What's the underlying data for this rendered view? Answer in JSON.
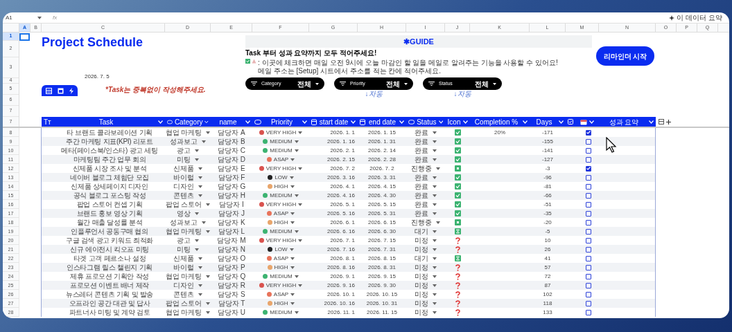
{
  "toolbar": {
    "cell_ref": "A1",
    "fx": "fx",
    "summary_button": "이 데이터 요약"
  },
  "column_letters": [
    {
      "label": "A",
      "selected": true
    },
    {
      "label": "B",
      "selected": false
    },
    {
      "label": "C",
      "selected": false
    },
    {
      "label": "D",
      "selected": false
    },
    {
      "label": "E",
      "selected": false
    },
    {
      "label": "F",
      "selected": false
    },
    {
      "label": "G",
      "selected": false
    },
    {
      "label": "H",
      "selected": false
    },
    {
      "label": "I",
      "selected": false
    },
    {
      "label": "J",
      "selected": false
    },
    {
      "label": "K",
      "selected": false
    },
    {
      "label": "L",
      "selected": false
    },
    {
      "label": "M",
      "selected": false
    },
    {
      "label": "N",
      "selected": false
    },
    {
      "label": "O",
      "selected": false
    },
    {
      "label": "P",
      "selected": false
    },
    {
      "label": "Q",
      "selected": false
    }
  ],
  "upper_rows": [
    {
      "label": "1",
      "selected": true
    },
    {
      "label": "2",
      "selected": false
    },
    {
      "label": "3",
      "selected": false
    },
    {
      "label": "4",
      "selected": false
    },
    {
      "label": "5",
      "selected": false
    },
    {
      "label": "6",
      "selected": false
    },
    {
      "label": "7",
      "selected": false
    }
  ],
  "title": "Project Schedule",
  "date": "2026. 7. 5",
  "note": "*Task는 중복없이 작성해주세요.",
  "guide": {
    "heading": "✱GUIDE",
    "line1": "Task 부터  성과 요약까지 모두 적어주세요!",
    "line2": ": 이곳에 체크하면 매일 오전 9시에 오늘 마감인 할 일을 메일로 알려주는 기능을 사용할 수 있어요!",
    "line3": "메일 주소는 [Setup] 시트에서 주소를 적는 칸에 적어주세요."
  },
  "reminder_button": "리마인더 시작",
  "header_row": "7",
  "filters": [
    {
      "label": "Category",
      "value": "전체"
    },
    {
      "label": "Priority",
      "value": "전체",
      "auto": "↓자동"
    },
    {
      "label": "Status",
      "value": "전체",
      "auto": "↓자동"
    }
  ],
  "columns": [
    {
      "label": "Tт",
      "kind": "type"
    },
    {
      "label": "Task",
      "kind": "text"
    },
    {
      "label": "Category",
      "kind": "chip"
    },
    {
      "label": "name",
      "kind": "text"
    },
    {
      "label": "Priority",
      "kind": "chip"
    },
    {
      "label": "start date",
      "kind": "date"
    },
    {
      "label": "end date",
      "kind": "date"
    },
    {
      "label": "Status",
      "kind": "chip"
    },
    {
      "label": "Icon",
      "kind": "text"
    },
    {
      "label": "Completion %",
      "kind": "text"
    },
    {
      "label": "Days",
      "kind": "text"
    },
    {
      "kind": "checkbox"
    },
    {
      "kind": "calendar"
    },
    {
      "label": "성과 요약",
      "kind": "text"
    }
  ],
  "rows": [
    {
      "num": "8",
      "task": "타 브랜드 콜라보레이션 기획",
      "category": "협업 마케팅",
      "name": "담당자 A",
      "priority": {
        "label": "VERY HIGH",
        "color": "#d9534f"
      },
      "start": "2026. 1. 1",
      "end": "2026. 1. 15",
      "status": "완료",
      "kind": "done",
      "completion": "20%",
      "days": "-171",
      "checked": true
    },
    {
      "num": "9",
      "task": "주간 마케팅 지표(KPI) 리포트",
      "category": "성과보고",
      "name": "담당자 B",
      "priority": {
        "label": "MEDIUM",
        "color": "#3cb371"
      },
      "start": "2026. 1. 16",
      "end": "2026. 1. 31",
      "status": "완료",
      "kind": "done",
      "days": "-155",
      "checked": false
    },
    {
      "num": "10",
      "task": "메타(페이스북/인스타) 광고 세팅",
      "category": "광고",
      "name": "담당자 C",
      "priority": {
        "label": "MEDIUM",
        "color": "#3cb371"
      },
      "start": "2026. 2. 1",
      "end": "2026. 2. 14",
      "status": "완료",
      "kind": "done",
      "days": "-141",
      "checked": false
    },
    {
      "num": "11",
      "task": "마케팅팀 주간 업무 회의",
      "category": "미팅",
      "name": "담당자 D",
      "priority": {
        "label": "ASAP",
        "color": "#e8735a"
      },
      "start": "2026. 2. 15",
      "end": "2026. 2. 28",
      "status": "완료",
      "kind": "done",
      "days": "-127",
      "checked": false
    },
    {
      "num": "12",
      "task": "신제품 시장 조사 및 분석",
      "category": "신제품",
      "name": "담당자 E",
      "priority": {
        "label": "VERY HIGH",
        "color": "#d9534f"
      },
      "start": "2026. 7. 2",
      "end": "2026. 7. 2",
      "status": "진행중",
      "kind": "progress",
      "days": "-3",
      "checked": true
    },
    {
      "num": "13",
      "task": "네이버 블로그 체험단 모집",
      "category": "바이럴",
      "name": "담당자 F",
      "priority": {
        "label": "LOW",
        "color": "#222222"
      },
      "start": "2026. 3. 16",
      "end": "2026. 3. 31",
      "status": "완료",
      "kind": "done",
      "days": "-96",
      "checked": false
    },
    {
      "num": "14",
      "task": "신제품 상세페이지 디자인",
      "category": "디자인",
      "name": "담당자 G",
      "priority": {
        "label": "HIGH",
        "color": "#e8a56b"
      },
      "start": "2026. 4. 1",
      "end": "2026. 4. 15",
      "status": "완료",
      "kind": "done",
      "days": "-81",
      "checked": false
    },
    {
      "num": "15",
      "task": "공식 블로그 포스팅 작성",
      "category": "콘텐츠",
      "name": "담당자 H",
      "priority": {
        "label": "MEDIUM",
        "color": "#3cb371"
      },
      "start": "2026. 4. 16",
      "end": "2026. 4. 30",
      "status": "완료",
      "kind": "done",
      "days": "-66",
      "checked": false
    },
    {
      "num": "16",
      "task": "팝업 스토어 컨셉 기획",
      "category": "팝업 스토어",
      "name": "담당자 I",
      "priority": {
        "label": "VERY HIGH",
        "color": "#d9534f"
      },
      "start": "2026. 5. 1",
      "end": "2026. 5. 15",
      "status": "완료",
      "kind": "done",
      "days": "-51",
      "checked": false
    },
    {
      "num": "17",
      "task": "브랜드 홍보 영상 기획",
      "category": "영상",
      "name": "담당자 J",
      "priority": {
        "label": "ASAP",
        "color": "#e8735a"
      },
      "start": "2026. 5. 16",
      "end": "2026. 5. 31",
      "status": "완료",
      "kind": "done",
      "days": "-35",
      "checked": false
    },
    {
      "num": "18",
      "task": "월간 매출 달성률 분석",
      "category": "성과보고",
      "name": "담당자 K",
      "priority": {
        "label": "HIGH",
        "color": "#e8a56b"
      },
      "start": "2026. 6. 1",
      "end": "2026. 6. 15",
      "status": "진행중",
      "kind": "progress",
      "days": "-20",
      "checked": false
    },
    {
      "num": "19",
      "task": "인플루언서 공동구매 협의",
      "category": "협업 마케팅",
      "name": "담당자 L",
      "priority": {
        "label": "MEDIUM",
        "color": "#3cb371"
      },
      "start": "2026. 6. 16",
      "end": "2026. 6. 30",
      "status": "대기",
      "kind": "waiting",
      "days": "-5",
      "checked": false
    },
    {
      "num": "20",
      "task": "구글 검색 광고 키워드 최적화",
      "category": "광고",
      "name": "담당자 M",
      "priority": {
        "label": "VERY HIGH",
        "color": "#d9534f"
      },
      "start": "2026. 7. 1",
      "end": "2026. 7. 15",
      "status": "미정",
      "kind": "unknown",
      "days": "10",
      "checked": false
    },
    {
      "num": "21",
      "task": "신규 에이전시 킥오프 미팅",
      "category": "미팅",
      "name": "담당자 N",
      "priority": {
        "label": "LOW",
        "color": "#222222"
      },
      "start": "2026. 7. 16",
      "end": "2026. 7. 31",
      "status": "미정",
      "kind": "unknown",
      "days": "26",
      "checked": false
    },
    {
      "num": "22",
      "task": "타겟 고객 페르소나 설정",
      "category": "신제품",
      "name": "담당자 O",
      "priority": {
        "label": "ASAP",
        "color": "#e8735a"
      },
      "start": "2026. 8. 1",
      "end": "2026. 8. 15",
      "status": "대기",
      "kind": "waiting",
      "days": "41",
      "checked": false
    },
    {
      "num": "23",
      "task": "인스타그램 릴스 챌린지 기획",
      "category": "바이럴",
      "name": "담당자 P",
      "priority": {
        "label": "HIGH",
        "color": "#e8a56b"
      },
      "start": "2026. 8. 16",
      "end": "2026. 8. 31",
      "status": "미정",
      "kind": "unknown",
      "days": "57",
      "checked": false
    },
    {
      "num": "24",
      "task": "제휴 프로모션 기획안 작성",
      "category": "협업 마케팅",
      "name": "담당자 Q",
      "priority": {
        "label": "MEDIUM",
        "color": "#3cb371"
      },
      "start": "2026. 9. 1",
      "end": "2026. 9. 15",
      "status": "미정",
      "kind": "unknown",
      "days": "72",
      "checked": false
    },
    {
      "num": "25",
      "task": "프로모션 이벤트 배너 제작",
      "category": "디자인",
      "name": "담당자 R",
      "priority": {
        "label": "VERY HIGH",
        "color": "#d9534f"
      },
      "start": "2026. 9. 16",
      "end": "2026. 9. 30",
      "status": "미정",
      "kind": "unknown",
      "days": "87",
      "checked": false
    },
    {
      "num": "26",
      "task": "뉴스레터 콘텐츠 기획 및 발송",
      "category": "콘텐츠",
      "name": "담당자 S",
      "priority": {
        "label": "ASAP",
        "color": "#e8735a"
      },
      "start": "2026. 10. 1",
      "end": "2026. 10. 15",
      "status": "미정",
      "kind": "unknown",
      "days": "102",
      "checked": false
    },
    {
      "num": "27",
      "task": "오프라인 공간 대관 및 답사",
      "category": "팝업 스토어",
      "name": "담당자 T",
      "priority": {
        "label": "HIGH",
        "color": "#e8a56b"
      },
      "start": "2026. 10. 16",
      "end": "2026. 10. 31",
      "status": "미정",
      "kind": "unknown",
      "days": "118",
      "checked": false
    },
    {
      "num": "28",
      "task": "파트너사 미팅 및 계약 검토",
      "category": "협업 마케팅",
      "name": "담당자 U",
      "priority": {
        "label": "MEDIUM",
        "color": "#3cb371"
      },
      "start": "2026. 11. 1",
      "end": "2026. 11. 15",
      "status": "미정",
      "kind": "unknown",
      "days": "133",
      "checked": false
    }
  ]
}
